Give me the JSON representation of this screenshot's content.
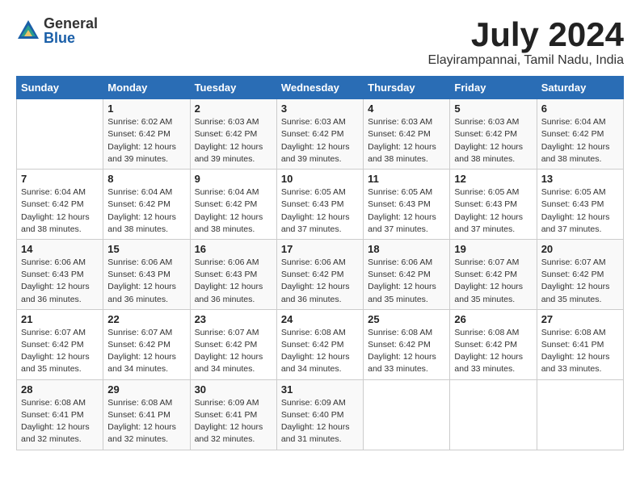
{
  "logo": {
    "general": "General",
    "blue": "Blue"
  },
  "title": "July 2024",
  "subtitle": "Elayirampannai, Tamil Nadu, India",
  "days_of_week": [
    "Sunday",
    "Monday",
    "Tuesday",
    "Wednesday",
    "Thursday",
    "Friday",
    "Saturday"
  ],
  "weeks": [
    [
      {
        "day": "",
        "info": ""
      },
      {
        "day": "1",
        "info": "Sunrise: 6:02 AM\nSunset: 6:42 PM\nDaylight: 12 hours\nand 39 minutes."
      },
      {
        "day": "2",
        "info": "Sunrise: 6:03 AM\nSunset: 6:42 PM\nDaylight: 12 hours\nand 39 minutes."
      },
      {
        "day": "3",
        "info": "Sunrise: 6:03 AM\nSunset: 6:42 PM\nDaylight: 12 hours\nand 39 minutes."
      },
      {
        "day": "4",
        "info": "Sunrise: 6:03 AM\nSunset: 6:42 PM\nDaylight: 12 hours\nand 38 minutes."
      },
      {
        "day": "5",
        "info": "Sunrise: 6:03 AM\nSunset: 6:42 PM\nDaylight: 12 hours\nand 38 minutes."
      },
      {
        "day": "6",
        "info": "Sunrise: 6:04 AM\nSunset: 6:42 PM\nDaylight: 12 hours\nand 38 minutes."
      }
    ],
    [
      {
        "day": "7",
        "info": "Sunrise: 6:04 AM\nSunset: 6:42 PM\nDaylight: 12 hours\nand 38 minutes."
      },
      {
        "day": "8",
        "info": "Sunrise: 6:04 AM\nSunset: 6:42 PM\nDaylight: 12 hours\nand 38 minutes."
      },
      {
        "day": "9",
        "info": "Sunrise: 6:04 AM\nSunset: 6:42 PM\nDaylight: 12 hours\nand 38 minutes."
      },
      {
        "day": "10",
        "info": "Sunrise: 6:05 AM\nSunset: 6:43 PM\nDaylight: 12 hours\nand 37 minutes."
      },
      {
        "day": "11",
        "info": "Sunrise: 6:05 AM\nSunset: 6:43 PM\nDaylight: 12 hours\nand 37 minutes."
      },
      {
        "day": "12",
        "info": "Sunrise: 6:05 AM\nSunset: 6:43 PM\nDaylight: 12 hours\nand 37 minutes."
      },
      {
        "day": "13",
        "info": "Sunrise: 6:05 AM\nSunset: 6:43 PM\nDaylight: 12 hours\nand 37 minutes."
      }
    ],
    [
      {
        "day": "14",
        "info": "Sunrise: 6:06 AM\nSunset: 6:43 PM\nDaylight: 12 hours\nand 36 minutes."
      },
      {
        "day": "15",
        "info": "Sunrise: 6:06 AM\nSunset: 6:43 PM\nDaylight: 12 hours\nand 36 minutes."
      },
      {
        "day": "16",
        "info": "Sunrise: 6:06 AM\nSunset: 6:43 PM\nDaylight: 12 hours\nand 36 minutes."
      },
      {
        "day": "17",
        "info": "Sunrise: 6:06 AM\nSunset: 6:42 PM\nDaylight: 12 hours\nand 36 minutes."
      },
      {
        "day": "18",
        "info": "Sunrise: 6:06 AM\nSunset: 6:42 PM\nDaylight: 12 hours\nand 35 minutes."
      },
      {
        "day": "19",
        "info": "Sunrise: 6:07 AM\nSunset: 6:42 PM\nDaylight: 12 hours\nand 35 minutes."
      },
      {
        "day": "20",
        "info": "Sunrise: 6:07 AM\nSunset: 6:42 PM\nDaylight: 12 hours\nand 35 minutes."
      }
    ],
    [
      {
        "day": "21",
        "info": "Sunrise: 6:07 AM\nSunset: 6:42 PM\nDaylight: 12 hours\nand 35 minutes."
      },
      {
        "day": "22",
        "info": "Sunrise: 6:07 AM\nSunset: 6:42 PM\nDaylight: 12 hours\nand 34 minutes."
      },
      {
        "day": "23",
        "info": "Sunrise: 6:07 AM\nSunset: 6:42 PM\nDaylight: 12 hours\nand 34 minutes."
      },
      {
        "day": "24",
        "info": "Sunrise: 6:08 AM\nSunset: 6:42 PM\nDaylight: 12 hours\nand 34 minutes."
      },
      {
        "day": "25",
        "info": "Sunrise: 6:08 AM\nSunset: 6:42 PM\nDaylight: 12 hours\nand 33 minutes."
      },
      {
        "day": "26",
        "info": "Sunrise: 6:08 AM\nSunset: 6:42 PM\nDaylight: 12 hours\nand 33 minutes."
      },
      {
        "day": "27",
        "info": "Sunrise: 6:08 AM\nSunset: 6:41 PM\nDaylight: 12 hours\nand 33 minutes."
      }
    ],
    [
      {
        "day": "28",
        "info": "Sunrise: 6:08 AM\nSunset: 6:41 PM\nDaylight: 12 hours\nand 32 minutes."
      },
      {
        "day": "29",
        "info": "Sunrise: 6:08 AM\nSunset: 6:41 PM\nDaylight: 12 hours\nand 32 minutes."
      },
      {
        "day": "30",
        "info": "Sunrise: 6:09 AM\nSunset: 6:41 PM\nDaylight: 12 hours\nand 32 minutes."
      },
      {
        "day": "31",
        "info": "Sunrise: 6:09 AM\nSunset: 6:40 PM\nDaylight: 12 hours\nand 31 minutes."
      },
      {
        "day": "",
        "info": ""
      },
      {
        "day": "",
        "info": ""
      },
      {
        "day": "",
        "info": ""
      }
    ]
  ]
}
